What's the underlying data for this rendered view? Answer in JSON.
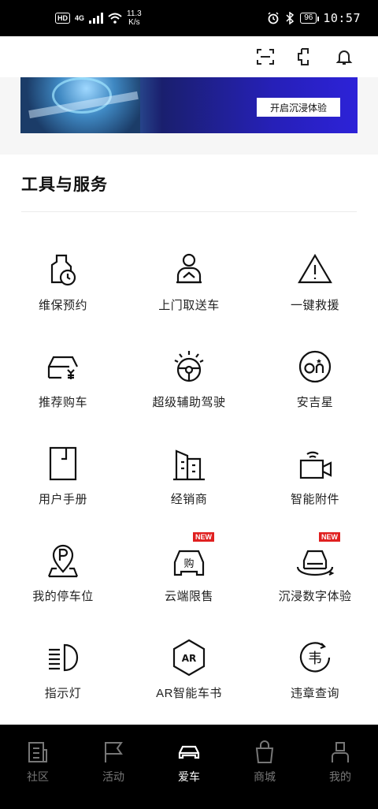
{
  "status_bar": {
    "hd": "HD",
    "network": "4G",
    "speed_value": "11.3",
    "speed_unit": "K/s",
    "battery": "96",
    "time": "10:57"
  },
  "header": {
    "icons": [
      "scan-icon",
      "phone-icon",
      "bell-icon"
    ]
  },
  "banner": {
    "cta_label": "开启沉浸体验"
  },
  "section": {
    "title": "工具与服务"
  },
  "services": [
    {
      "label": "维保预约",
      "icon": "maintenance-icon"
    },
    {
      "label": "上门取送车",
      "icon": "pickup-delivery-icon"
    },
    {
      "label": "一键救援",
      "icon": "warning-triangle-icon"
    },
    {
      "label": "推荐购车",
      "icon": "recommend-car-icon"
    },
    {
      "label": "超级辅助驾驶",
      "icon": "steering-wheel-icon"
    },
    {
      "label": "安吉星",
      "icon": "onstar-icon"
    },
    {
      "label": "用户手册",
      "icon": "manual-icon"
    },
    {
      "label": "经销商",
      "icon": "dealer-building-icon"
    },
    {
      "label": "智能附件",
      "icon": "camera-accessory-icon"
    },
    {
      "label": "我的停车位",
      "icon": "parking-icon"
    },
    {
      "label": "云端限售",
      "icon": "cloud-sale-icon",
      "badge": "NEW"
    },
    {
      "label": "沉浸数字体验",
      "icon": "immersive-experience-icon",
      "badge": "NEW"
    },
    {
      "label": "指示灯",
      "icon": "indicator-light-icon"
    },
    {
      "label": "AR智能车书",
      "icon": "ar-book-icon"
    },
    {
      "label": "违章查询",
      "icon": "violation-query-icon"
    }
  ],
  "nav": [
    {
      "label": "社区",
      "icon": "community-icon",
      "active": false
    },
    {
      "label": "活动",
      "icon": "flag-icon",
      "active": false
    },
    {
      "label": "爱车",
      "icon": "car-icon",
      "active": true
    },
    {
      "label": "商城",
      "icon": "shopping-bag-icon",
      "active": false
    },
    {
      "label": "我的",
      "icon": "profile-icon",
      "active": false
    }
  ],
  "colors": {
    "status_bar_bg": "#000000",
    "nav_bg": "#000000",
    "badge_red": "#e02020",
    "banner_blue": "#2d22d8"
  }
}
